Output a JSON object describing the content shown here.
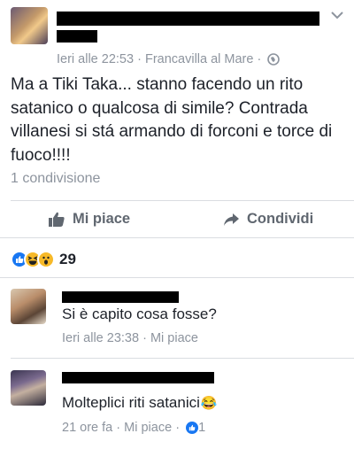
{
  "post": {
    "time": "Ieri alle 22:53",
    "sep1": "·",
    "location": "Francavilla al Mare",
    "sep2": "·",
    "text": "Ma a Tiki Taka... stanno facendo un rito satanico o qualcosa di simile? Contrada villanesi si stá armando di forconi e torce di fuoco!!!!",
    "shares": "1 condivisione"
  },
  "actions": {
    "like": "Mi piace",
    "share": "Condividi"
  },
  "reactions": {
    "count": "29",
    "icons": [
      "like-icon",
      "haha-icon",
      "wow-icon"
    ]
  },
  "comments": [
    {
      "text": "Si è capito cosa fosse?",
      "time": "Ieri alle 23:38",
      "sep": "·",
      "like": "Mi piace"
    },
    {
      "text": "Molteplici riti satanici",
      "emoji": "😂",
      "time": "21 ore fa",
      "sep": "·",
      "like": "Mi piace",
      "sep2": "·",
      "likes": "1"
    }
  ]
}
